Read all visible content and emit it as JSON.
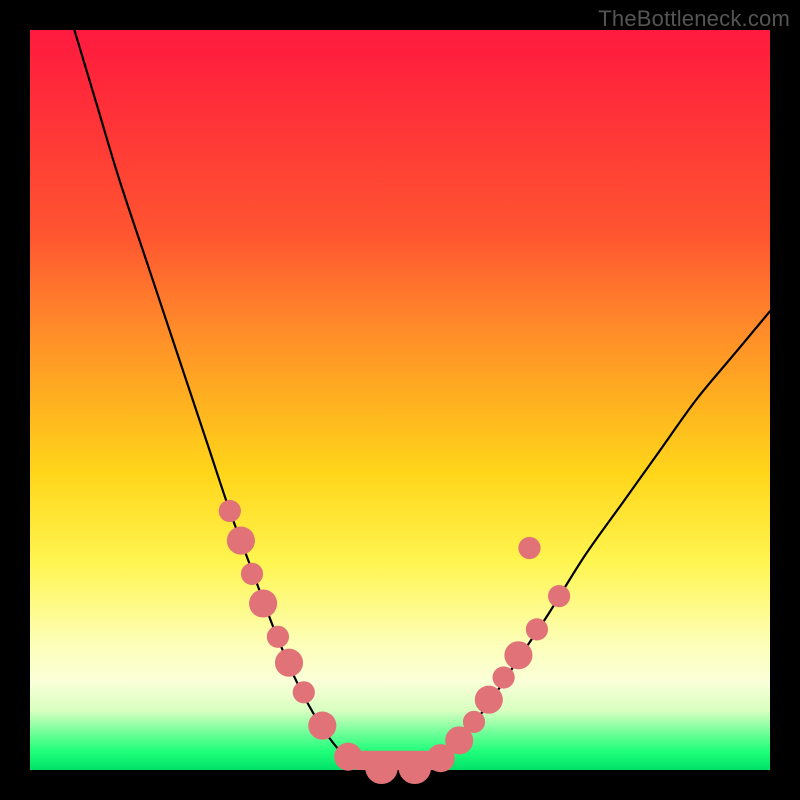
{
  "watermark": "TheBottleneck.com",
  "chart_data": {
    "type": "line",
    "title": "",
    "xlabel": "",
    "ylabel": "",
    "xlim": [
      0,
      100
    ],
    "ylim": [
      0,
      100
    ],
    "grid": false,
    "series": [
      {
        "name": "left-arm",
        "stroke": "#000000",
        "values": [
          [
            6,
            100
          ],
          [
            9,
            90
          ],
          [
            12,
            80
          ],
          [
            16,
            68
          ],
          [
            20,
            56
          ],
          [
            24,
            44
          ],
          [
            27,
            35
          ],
          [
            30,
            27
          ],
          [
            33,
            19
          ],
          [
            36,
            12
          ],
          [
            39,
            6.5
          ],
          [
            42,
            2.5
          ],
          [
            45,
            0.8
          ],
          [
            48,
            0.2
          ],
          [
            50,
            0.1
          ]
        ]
      },
      {
        "name": "right-arm",
        "stroke": "#000000",
        "values": [
          [
            50,
            0.1
          ],
          [
            52,
            0.3
          ],
          [
            55,
            1.5
          ],
          [
            58,
            4
          ],
          [
            62,
            9
          ],
          [
            66,
            15
          ],
          [
            70,
            21
          ],
          [
            75,
            29
          ],
          [
            80,
            36
          ],
          [
            85,
            43
          ],
          [
            90,
            50
          ],
          [
            95,
            56
          ],
          [
            100,
            62
          ]
        ]
      }
    ],
    "markers": [
      {
        "name": "left-arm-marker",
        "cx": 27.0,
        "cy": 35.0,
        "r": 1.5,
        "fill": "#e17277"
      },
      {
        "name": "left-arm-marker",
        "cx": 28.5,
        "cy": 31.0,
        "r": 1.9,
        "fill": "#e17277"
      },
      {
        "name": "left-arm-marker",
        "cx": 30.0,
        "cy": 26.5,
        "r": 1.5,
        "fill": "#e17277"
      },
      {
        "name": "left-arm-marker",
        "cx": 31.5,
        "cy": 22.5,
        "r": 1.9,
        "fill": "#e17277"
      },
      {
        "name": "left-arm-marker",
        "cx": 33.5,
        "cy": 18.0,
        "r": 1.5,
        "fill": "#e17277"
      },
      {
        "name": "left-arm-marker",
        "cx": 35.0,
        "cy": 14.5,
        "r": 1.9,
        "fill": "#e17277"
      },
      {
        "name": "left-arm-marker",
        "cx": 37.0,
        "cy": 10.5,
        "r": 1.5,
        "fill": "#e17277"
      },
      {
        "name": "left-arm-marker",
        "cx": 39.5,
        "cy": 6.0,
        "r": 1.9,
        "fill": "#e17277"
      },
      {
        "name": "trough-marker",
        "cx": 43.0,
        "cy": 1.8,
        "r": 1.9,
        "fill": "#e17277"
      },
      {
        "name": "trough-marker",
        "cx": 47.5,
        "cy": 0.3,
        "r": 2.2,
        "fill": "#e17277"
      },
      {
        "name": "trough-marker",
        "cx": 52.0,
        "cy": 0.3,
        "r": 2.2,
        "fill": "#e17277"
      },
      {
        "name": "trough-marker",
        "cx": 55.5,
        "cy": 1.6,
        "r": 1.9,
        "fill": "#e17277"
      },
      {
        "name": "right-arm-marker",
        "cx": 58.0,
        "cy": 4.0,
        "r": 1.9,
        "fill": "#e17277"
      },
      {
        "name": "right-arm-marker",
        "cx": 60.0,
        "cy": 6.5,
        "r": 1.5,
        "fill": "#e17277"
      },
      {
        "name": "right-arm-marker",
        "cx": 62.0,
        "cy": 9.5,
        "r": 1.9,
        "fill": "#e17277"
      },
      {
        "name": "right-arm-marker",
        "cx": 64.0,
        "cy": 12.5,
        "r": 1.5,
        "fill": "#e17277"
      },
      {
        "name": "right-arm-marker",
        "cx": 66.0,
        "cy": 15.5,
        "r": 1.9,
        "fill": "#e17277"
      },
      {
        "name": "right-arm-marker",
        "cx": 68.5,
        "cy": 19.0,
        "r": 1.5,
        "fill": "#e17277"
      },
      {
        "name": "right-arm-marker",
        "cx": 71.5,
        "cy": 23.5,
        "r": 1.5,
        "fill": "#e17277"
      },
      {
        "name": "right-arm-marker",
        "cx": 67.5,
        "cy": 30.0,
        "r": 1.5,
        "fill": "#e17277"
      }
    ],
    "trough_band": {
      "from_x": 43,
      "to_x": 56,
      "height": 2.6,
      "fill": "#e17277"
    }
  }
}
